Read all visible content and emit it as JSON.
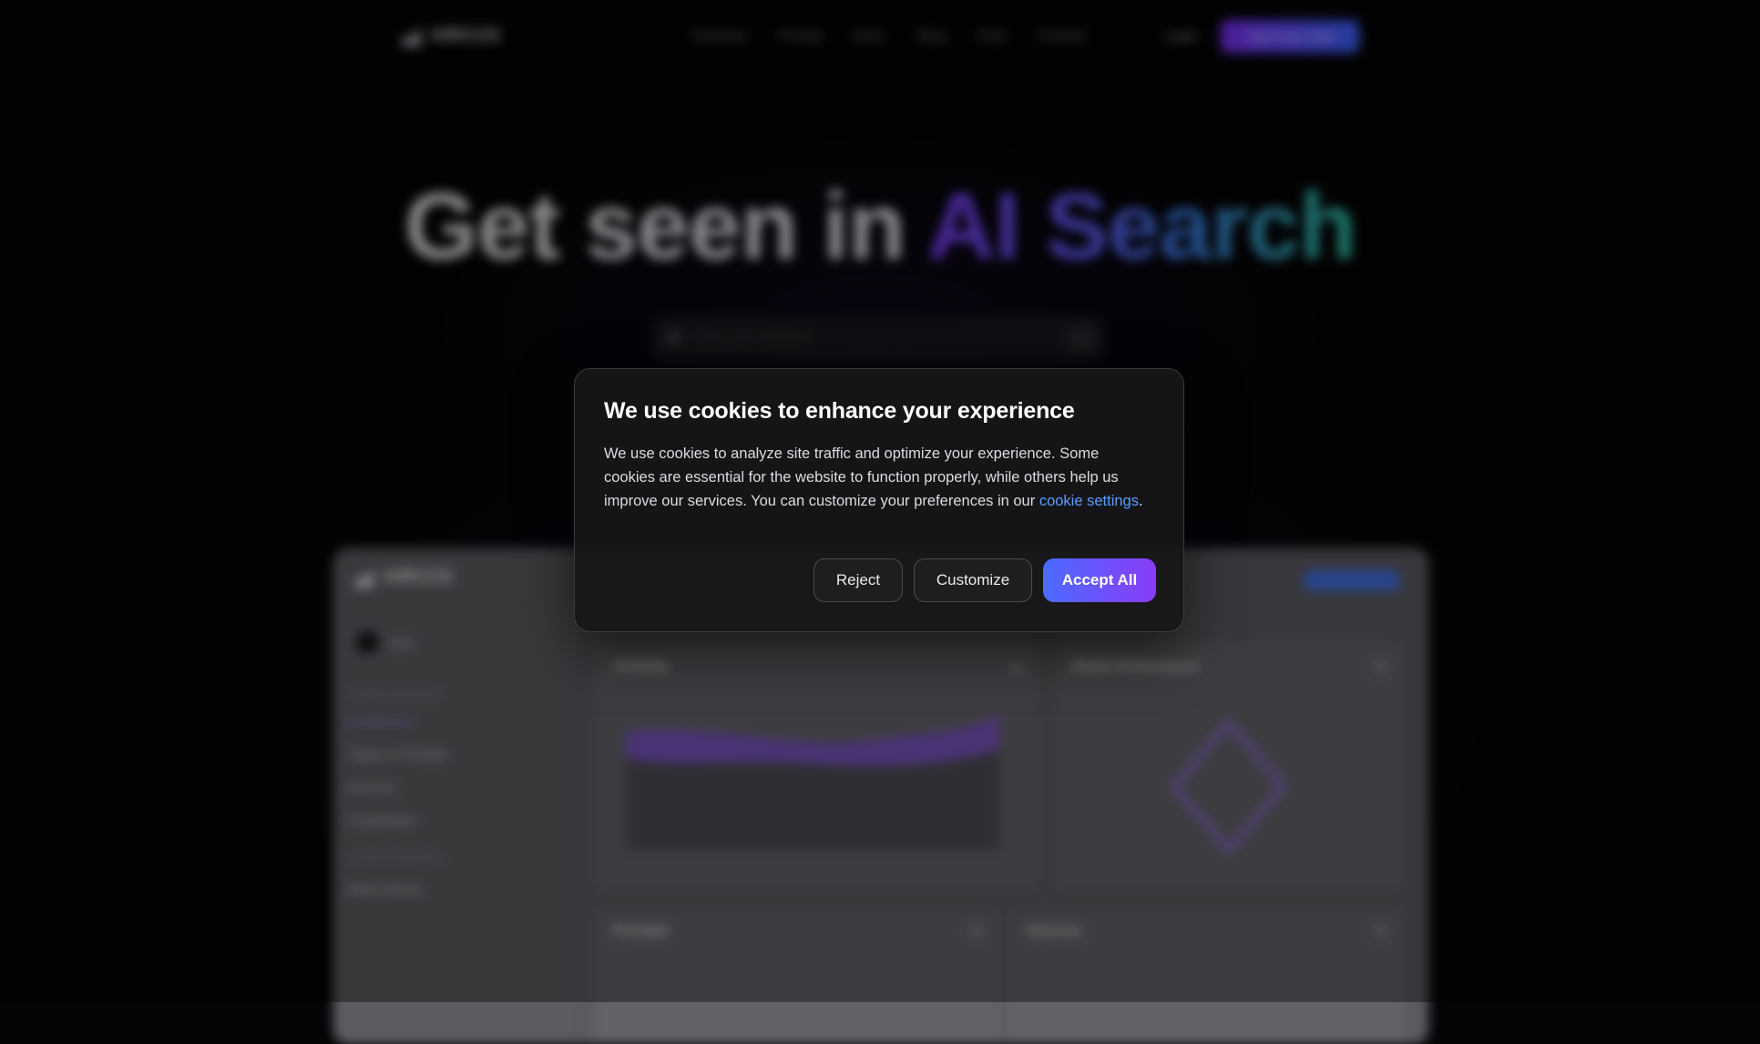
{
  "background": {
    "nav": {
      "logo_text": "AIRCUS",
      "links": [
        "Features",
        "Pricing",
        "Docs",
        "Blog",
        "FAQ",
        "Contact"
      ],
      "login_label": "Login",
      "cta_label": "Start Free Trial"
    },
    "hero": {
      "title_plain": "Get seen in ",
      "title_highlight": "AI Search",
      "search_placeholder": "Enter your website"
    },
    "dashboard": {
      "logo_text": "AIRCUS",
      "user_name": "User",
      "sections": [
        {
          "label": "Visibility Monitoring",
          "items": [
            "Dashboard",
            "Topics & Prompts",
            "Sources",
            "Competitors"
          ]
        },
        {
          "label": "Content Generation",
          "items": [
            "Write Articles"
          ]
        }
      ],
      "cards": [
        "Visibility",
        "Model Performance",
        "Prompts",
        "Sources"
      ]
    }
  },
  "modal": {
    "title": "We use cookies to enhance your experience",
    "body": "We use cookies to analyze site traffic and optimize your experience. Some cookies are essential for the website to function properly, while others help us improve our services. You can customize your preferences in our ",
    "link_text": "cookie settings",
    "body_end": ".",
    "buttons": {
      "reject": "Reject",
      "customize": "Customize",
      "accept": "Accept All"
    }
  },
  "colors": {
    "accent_gradient_start": "#4b6bff",
    "accent_gradient_end": "#8a3cf6",
    "link": "#5b9dff",
    "modal_bg": "#161618"
  }
}
